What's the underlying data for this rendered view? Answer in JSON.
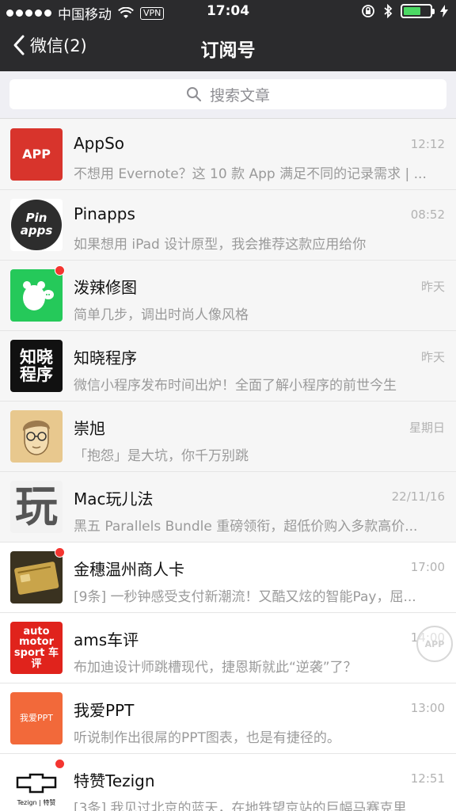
{
  "status": {
    "carrier": "中国移动",
    "vpn": "VPN",
    "time": "17:04",
    "battery_level": 0.65
  },
  "nav": {
    "back_label": "微信(2)",
    "title": "订阅号"
  },
  "search": {
    "placeholder": "搜索文章"
  },
  "items": [
    {
      "name": "AppSo",
      "time": "12:12",
      "preview": "不想用 Evernote？这 10 款 App 满足不同的记录需求 | ...",
      "unread": false,
      "avatar_text": "APP",
      "avatar_color": "#d8342c"
    },
    {
      "name": "Pinapps",
      "time": "08:52",
      "preview": "如果想用 iPad 设计原型，我会推荐这款应用给你",
      "unread": false,
      "avatar_text": "Pin apps",
      "avatar_color": "#2d2d2d"
    },
    {
      "name": "泼辣修图",
      "time": "昨天",
      "preview": "简单几步，调出时尚人像风格",
      "unread": true,
      "avatar_text": "",
      "avatar_color": "#25c95a"
    },
    {
      "name": "知晓程序",
      "time": "昨天",
      "preview": "微信小程序发布时间出炉！全面了解小程序的前世今生",
      "unread": false,
      "avatar_text": "知晓 程序",
      "avatar_color": "#111111"
    },
    {
      "name": "崇旭",
      "time": "星期日",
      "preview": "「抱怨」是大坑，你千万别跳",
      "unread": false,
      "avatar_text": "",
      "avatar_color": "#e8c88e"
    },
    {
      "name": "Mac玩儿法",
      "time": "22/11/16",
      "preview": "黑五 Parallels Bundle 重磅领衔，超低价购入多款高价...",
      "unread": false,
      "avatar_text": "玩",
      "avatar_color": "#f2f2f2"
    },
    {
      "name": "金穗温州商人卡",
      "time": "17:00",
      "preview": "[9条] 一秒钟感受支付新潮流！又酷又炫的智能Pay，屈...",
      "unread": true,
      "avatar_text": "",
      "avatar_color": "#3a3220"
    },
    {
      "name": "ams车评",
      "time": "14:00",
      "preview": "布加迪设计师跳槽现代，捷恩斯就此“逆袭”了？",
      "unread": false,
      "avatar_text": "auto motor sport 车评",
      "avatar_color": "#e0231c"
    },
    {
      "name": "我爱PPT",
      "time": "13:00",
      "preview": "听说制作出很屌的PPT图表，也是有捷径的。",
      "unread": false,
      "avatar_text": "我爱PPT",
      "avatar_color": "#f2693a"
    },
    {
      "name": "特赞Tezign",
      "time": "12:51",
      "preview": "[3条] 我见过北京的蓝天，在地铁望京站的巨幅马赛克里",
      "unread": true,
      "avatar_text": "Tezign | 特赞",
      "avatar_color": "#ffffff"
    }
  ],
  "watermark": "APP"
}
